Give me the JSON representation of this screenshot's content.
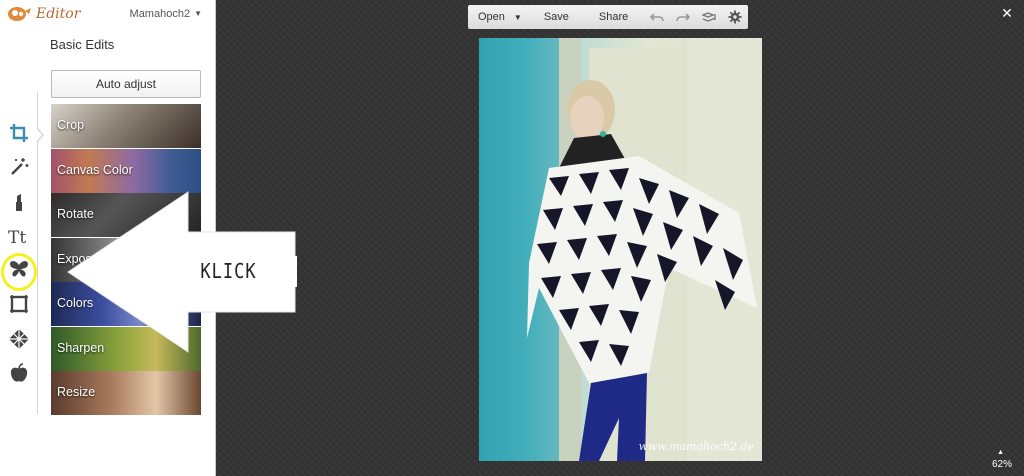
{
  "app": {
    "title": "Editor",
    "user": "Mamahoch2"
  },
  "panel": {
    "title": "Basic Edits",
    "auto_adjust": "Auto adjust",
    "items": [
      {
        "label": "Crop"
      },
      {
        "label": "Canvas Color"
      },
      {
        "label": "Rotate"
      },
      {
        "label": "Exposure"
      },
      {
        "label": "Colors"
      },
      {
        "label": "Sharpen"
      },
      {
        "label": "Resize"
      }
    ]
  },
  "rail": {
    "tools": [
      "crop-icon",
      "magic-wand-icon",
      "lipstick-icon",
      "text-icon",
      "butterfly-icon",
      "frame-icon",
      "texture-icon",
      "apple-icon"
    ],
    "active": "crop-icon",
    "highlight": "butterfly-icon",
    "accent": "#3a8fb0",
    "highlight_color": "#f2f21a"
  },
  "annotation": {
    "text": "KLICK"
  },
  "toolbar": {
    "open": "Open",
    "save": "Save",
    "share": "Share"
  },
  "photo": {
    "watermark": "www.mamahoch2.de"
  },
  "status": {
    "zoom": "62%"
  }
}
